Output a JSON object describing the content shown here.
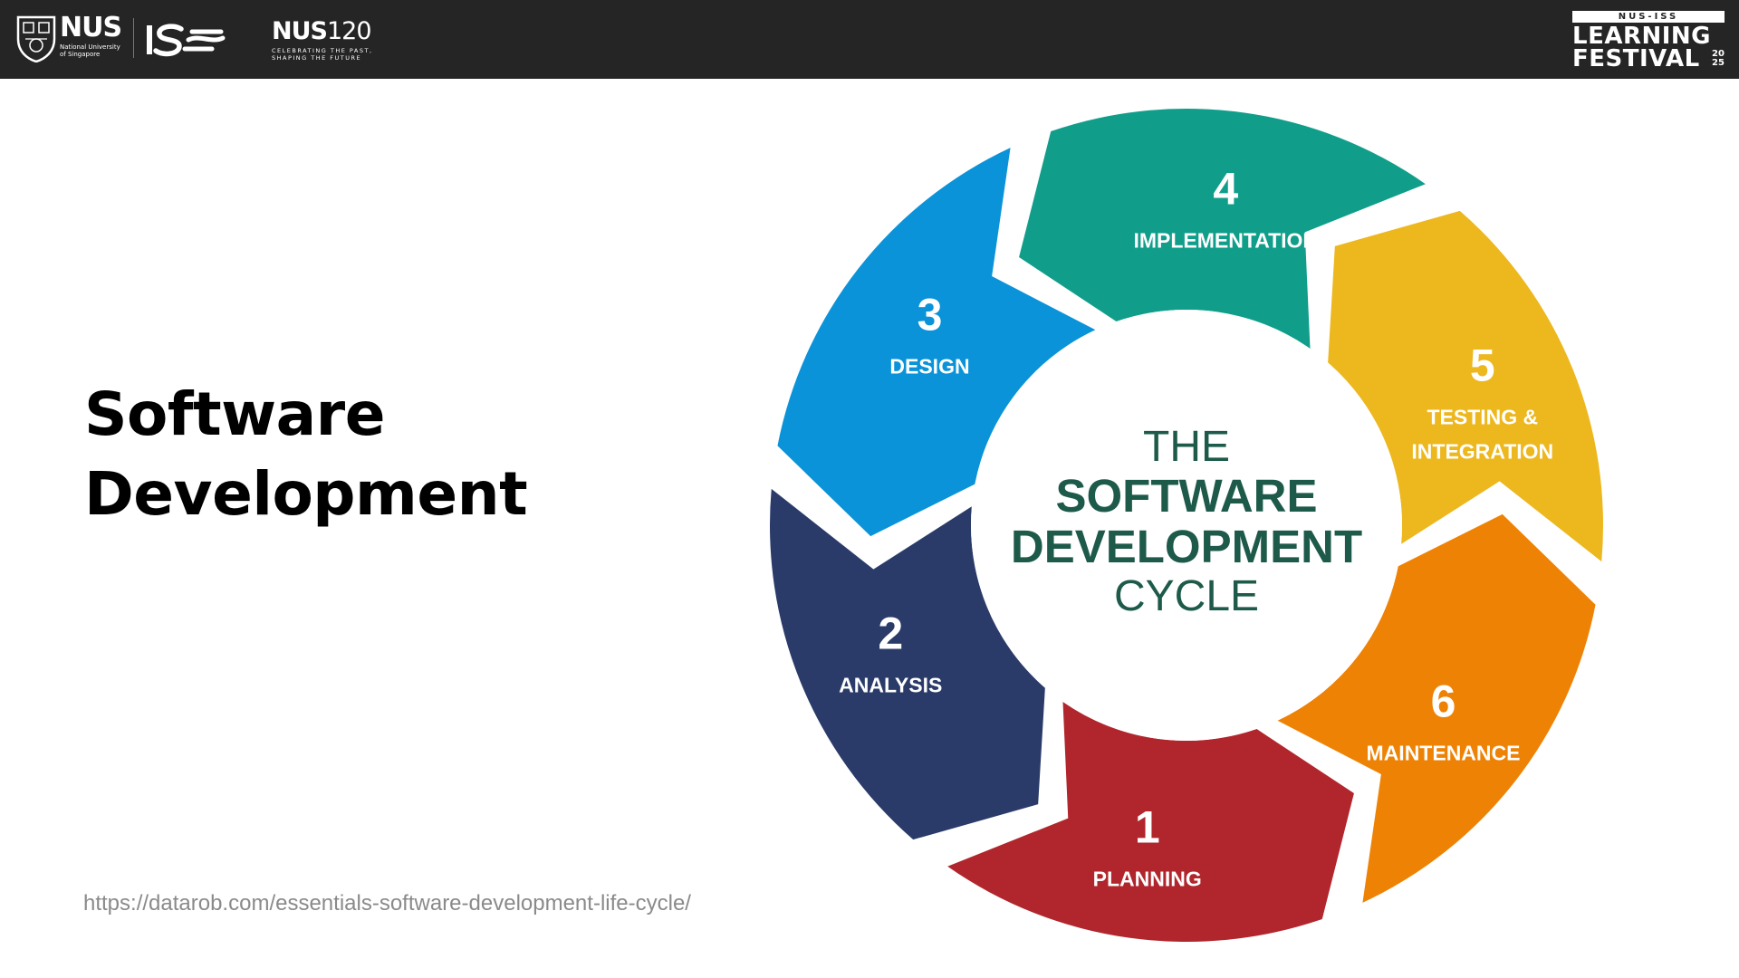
{
  "header": {
    "nus_logo": {
      "word": "NUS",
      "subtitle_line1": "National University",
      "subtitle_line2": "of Singapore"
    },
    "iss_logo": {
      "word": "ISS"
    },
    "nus120_logo": {
      "word_bold": "NUS",
      "word_thin": "120",
      "tagline1": "CELEBRATING THE PAST,",
      "tagline2": "SHAPING THE FUTURE"
    },
    "festival_logo": {
      "tag": "NUS-ISS",
      "line1": "LEARNING",
      "line2": "FESTIVAL",
      "year_top": "20",
      "year_bottom": "25"
    }
  },
  "slide": {
    "title_line1": "Software",
    "title_line2": "Development",
    "source_url": "https://datarob.com/essentials-software-development-life-cycle/"
  },
  "diagram": {
    "center": {
      "line1": "THE",
      "line2": "SOFTWARE",
      "line3": "DEVELOPMENT",
      "line4": "CYCLE"
    },
    "stages": [
      {
        "number": "1",
        "label_line1": "PLANNING",
        "label_line2": "",
        "color": "#B0262C"
      },
      {
        "number": "2",
        "label_line1": "ANALYSIS",
        "label_line2": "",
        "color": "#2A3B69"
      },
      {
        "number": "3",
        "label_line1": "DESIGN",
        "label_line2": "",
        "color": "#0A93D8"
      },
      {
        "number": "4",
        "label_line1": "IMPLEMENTATION",
        "label_line2": "",
        "color": "#109E8B"
      },
      {
        "number": "5",
        "label_line1": "TESTING &",
        "label_line2": "INTEGRATION",
        "color": "#EDB71E"
      },
      {
        "number": "6",
        "label_line1": "MAINTENANCE",
        "label_line2": "",
        "color": "#EE8205"
      }
    ],
    "center_text_color": "#1D5A4A",
    "header_bg": "#252525"
  }
}
